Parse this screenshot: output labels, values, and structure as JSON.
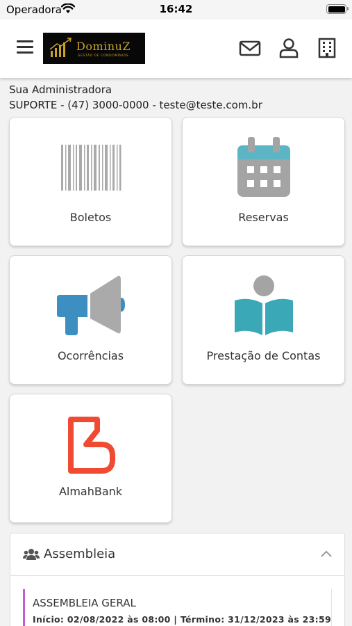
{
  "status_bar": {
    "carrier": "Operadora",
    "time": "16:42"
  },
  "header": {
    "logo_name": "DominuZ",
    "logo_subtitle": "GESTÃO DE CONDOMÍNIOS",
    "icons": [
      "menu-icon",
      "mail-icon",
      "user-icon",
      "building-icon"
    ]
  },
  "admin": {
    "title": "Sua Administradora",
    "contact": "SUPORTE - (47) 3000-0000 - teste@teste.com.br"
  },
  "cards": [
    {
      "label": "Boletos",
      "icon": "barcode-icon"
    },
    {
      "label": "Reservas",
      "icon": "calendar-icon"
    },
    {
      "label": "Ocorrências",
      "icon": "megaphone-icon"
    },
    {
      "label": "Prestação de Contas",
      "icon": "reading-person-icon"
    },
    {
      "label": "AlmahBank",
      "icon": "almahbank-logo-icon"
    }
  ],
  "assembleia": {
    "title": "Assembleia",
    "item_title": "ASSEMBLEIA GERAL",
    "item_dates": "Início: 02/08/2022 às 08:00 | Término: 31/12/2023 às 23:59"
  },
  "colors": {
    "calendar_header": "#5bb5c4",
    "calendar_body": "#a4a4a4",
    "megaphone_blue": "#3d8fc1",
    "book_teal": "#3ba8b8",
    "almahbank_red": "#f04a32",
    "assembly_accent": "#c75bd6",
    "logo_gold": "#c9a227"
  }
}
